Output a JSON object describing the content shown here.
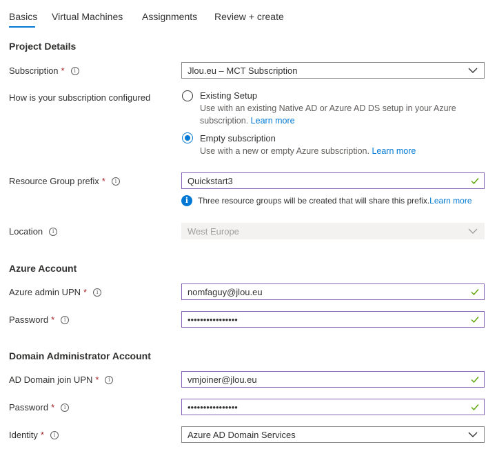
{
  "tabs": [
    {
      "label": "Basics"
    },
    {
      "label": "Virtual Machines"
    },
    {
      "label": "Assignments"
    },
    {
      "label": "Review + create"
    }
  ],
  "sections": {
    "project": "Project Details",
    "azure_account": "Azure Account",
    "domain_admin": "Domain Administrator Account"
  },
  "fields": {
    "subscription": {
      "label": "Subscription",
      "value": "Jlou.eu – MCT Subscription"
    },
    "config": {
      "label": "How is your subscription configured",
      "options": [
        {
          "title": "Existing Setup",
          "desc": "Use with an existing Native AD or Azure AD DS setup in your Azure subscription.",
          "link": "Learn more",
          "checked": false
        },
        {
          "title": "Empty subscription",
          "desc": "Use with a new or empty Azure subscription.",
          "link": "Learn more",
          "checked": true
        }
      ]
    },
    "rg_prefix": {
      "label": "Resource Group prefix",
      "value": "Quickstart3",
      "info": "Three resource groups will be created that will share this prefix.",
      "info_link": "Learn more"
    },
    "location": {
      "label": "Location",
      "value": "West Europe"
    },
    "azure_admin_upn": {
      "label": "Azure admin UPN",
      "value": "nomfaguy@jlou.eu"
    },
    "azure_password": {
      "label": "Password",
      "value": "••••••••••••••••"
    },
    "ad_join_upn": {
      "label": "AD Domain join UPN",
      "value": "vmjoiner@jlou.eu"
    },
    "ad_password": {
      "label": "Password",
      "value": "••••••••••••••••"
    },
    "identity": {
      "label": "Identity",
      "value": "Azure AD Domain Services"
    }
  },
  "colors": {
    "accent": "#0078d4",
    "required": "#a4262c",
    "valid_border": "#8764b8",
    "check": "#57a300"
  }
}
